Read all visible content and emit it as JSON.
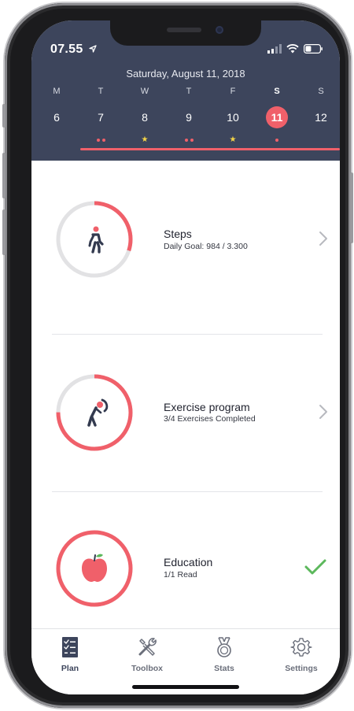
{
  "status_bar": {
    "time": "07.55"
  },
  "calendar": {
    "date_title": "Saturday, August 11, 2018",
    "days": [
      {
        "name": "M",
        "num": "6",
        "mark": "none"
      },
      {
        "name": "T",
        "num": "7",
        "mark": "dots"
      },
      {
        "name": "W",
        "num": "8",
        "mark": "star"
      },
      {
        "name": "T",
        "num": "9",
        "mark": "dots"
      },
      {
        "name": "F",
        "num": "10",
        "mark": "star"
      },
      {
        "name": "S",
        "num": "11",
        "mark": "dot",
        "selected": true
      },
      {
        "name": "S",
        "num": "12",
        "mark": "none"
      }
    ]
  },
  "tasks": {
    "steps": {
      "title": "Steps",
      "subtitle": "Daily Goal: 984 / 3.300",
      "progress": 0.3,
      "icon": "walking-person-icon"
    },
    "exercise": {
      "title": "Exercise program",
      "subtitle": "3/4 Exercises Completed",
      "progress": 0.75,
      "icon": "stretching-person-icon"
    },
    "education": {
      "title": "Education",
      "subtitle": "1/1 Read",
      "progress": 1.0,
      "icon": "apple-icon",
      "completed": true
    }
  },
  "tabbar": {
    "plan": {
      "label": "Plan",
      "icon": "checklist-icon",
      "active": true
    },
    "toolbox": {
      "label": "Toolbox",
      "icon": "tools-icon"
    },
    "stats": {
      "label": "Stats",
      "icon": "medal-icon"
    },
    "settings": {
      "label": "Settings",
      "icon": "gear-icon"
    }
  },
  "colors": {
    "header": "#3d455c",
    "accent": "#f0606a",
    "track": "#e2e2e4",
    "check": "#5cb85c",
    "star": "#f5d547"
  }
}
